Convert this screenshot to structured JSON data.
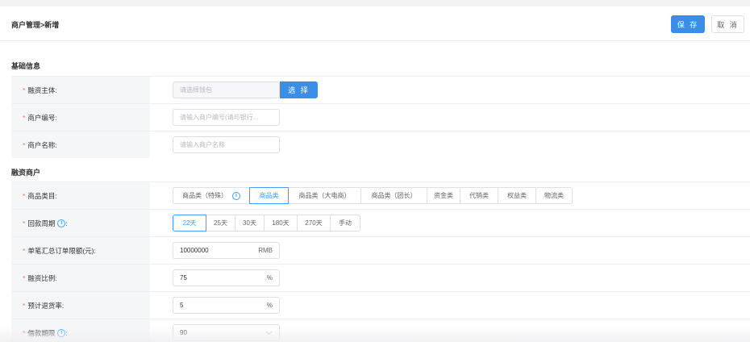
{
  "header": {
    "breadcrumb": "商户管理>新增",
    "save_label": "保 存",
    "cancel_label": "取 消"
  },
  "sections": {
    "basic_title": "基础信息",
    "finance_title": "融资商户"
  },
  "fields": {
    "subject": {
      "label": "融资主体:",
      "placeholder": "请选择钱包",
      "button": "选 择"
    },
    "merchant_no": {
      "label": "商户编号:",
      "placeholder": "请输入商户编号(请与银行..."
    },
    "merchant_name": {
      "label": "商户名称:",
      "placeholder": "请输入商户名称"
    },
    "category": {
      "label": "商品类目:",
      "options": [
        "商品类（特殊）",
        "商品类",
        "商品类（大电商）",
        "商品类（团长）",
        "资金类",
        "代销类",
        "权益类",
        "物流类"
      ],
      "selected": "商品类"
    },
    "payback": {
      "label": "回款周期",
      "options": [
        "22天",
        "25天",
        "30天",
        "180天",
        "270天",
        "手动"
      ],
      "selected": "22天"
    },
    "order_limit": {
      "label": "单笔汇总订单限额(元):",
      "value": "10000000",
      "unit": "RMB"
    },
    "finance_ratio": {
      "label": "融资比例:",
      "value": "75",
      "unit": "%"
    },
    "return_rate": {
      "label": "预计退货率:",
      "value": "5",
      "unit": "%"
    },
    "loan_term": {
      "label": "借款期限",
      "value": "90"
    }
  },
  "required_mark": "*",
  "colon": ":",
  "info_glyph": "i",
  "colors": {
    "primary": "#3a8ee6",
    "required": "#f56c6c",
    "label_bg": "#f5f6f8"
  }
}
